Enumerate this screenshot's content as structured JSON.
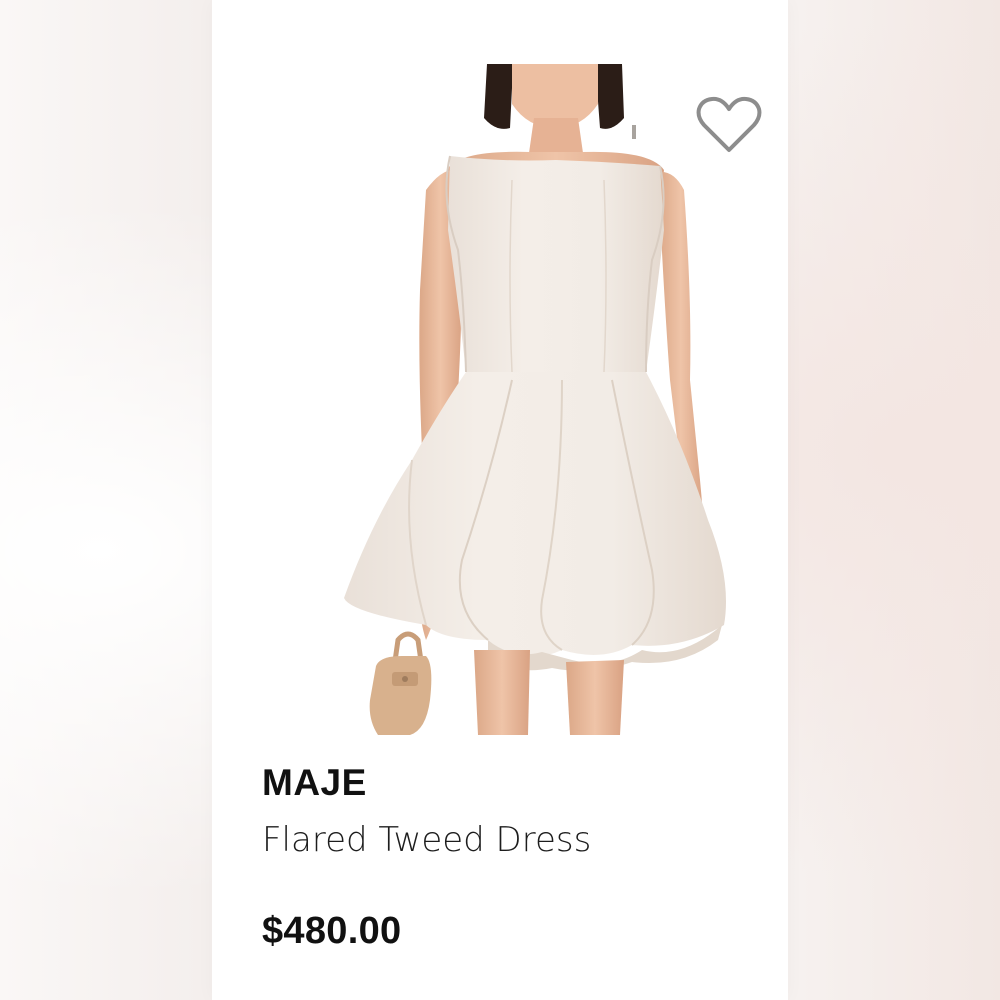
{
  "listing": {
    "brand": "MAJE",
    "title": "Flared Tweed Dress",
    "price": "$480.00",
    "favorite_icon": "heart-outline-icon",
    "image_subject": "product-photo"
  },
  "colors": {
    "dress": "#f2ebe4",
    "skin": "#e8b99c",
    "hair": "#2b1d17",
    "bag": "#d8b18d",
    "icon_stroke": "#8d8d8d"
  }
}
